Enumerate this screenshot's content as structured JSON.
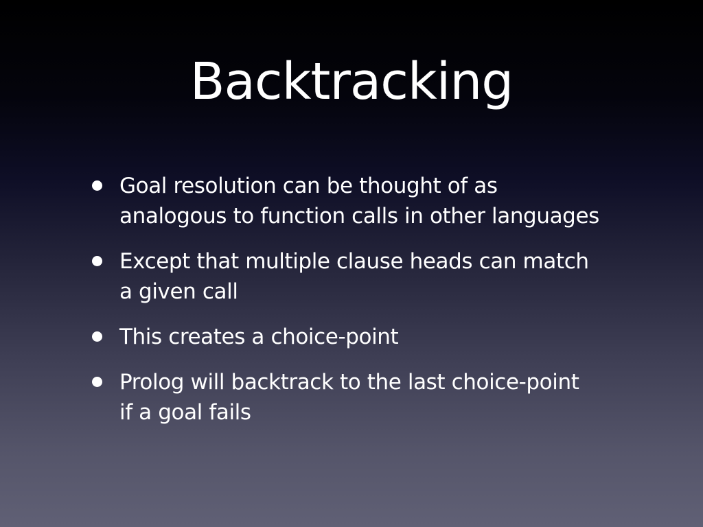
{
  "slide": {
    "title": "Backtracking",
    "bullets": [
      {
        "line1": "Goal resolution can be thought of as",
        "line2": "analogous to function calls in other languages"
      },
      {
        "line1": "Except that multiple clause heads can match",
        "line2": "a given call"
      },
      {
        "line1": "This creates a choice-point",
        "line2": ""
      },
      {
        "line1": "Prolog will backtrack to the last choice-point",
        "line2": "if a goal fails"
      }
    ]
  },
  "colors": {
    "background_top": "#000000",
    "background_bottom": "#606075",
    "text": "#ffffff"
  }
}
